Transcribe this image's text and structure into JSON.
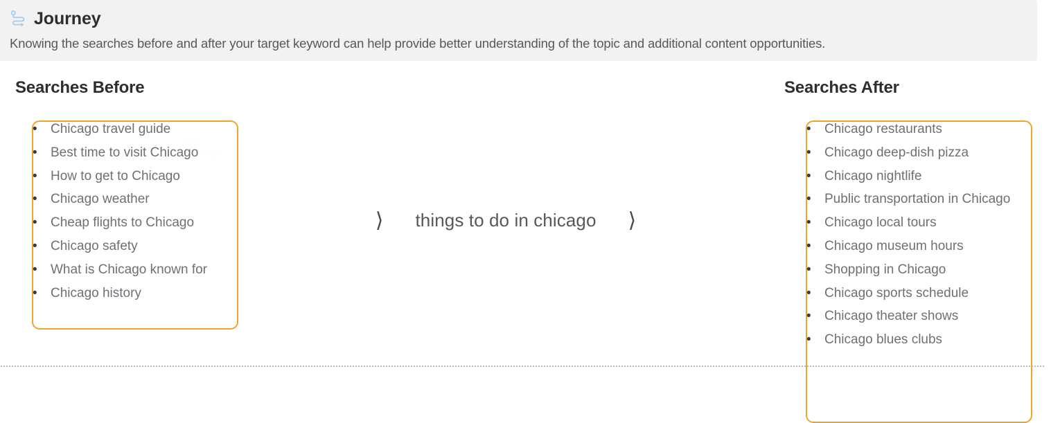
{
  "panel": {
    "icon": "route-journey-icon",
    "title": "Journey",
    "description": "Knowing the searches before and after your target keyword can help provide better understanding of the topic and additional content opportunities."
  },
  "colors": {
    "highlight_border": "#f0a52a",
    "icon_blue": "#a9cdef",
    "header_background": "#f2f2f2",
    "heading_text": "#2e2e2e",
    "list_text": "#6d7074"
  },
  "before": {
    "heading": "Searches Before",
    "items": [
      "Chicago travel guide",
      "Best time to visit Chicago",
      "How to get to Chicago",
      "Chicago weather",
      "Cheap flights to Chicago",
      "Chicago safety",
      "What is Chicago known for",
      "Chicago history"
    ]
  },
  "center": {
    "left_chevron": "⟩",
    "keyword": "things to do in chicago",
    "right_chevron": "⟩"
  },
  "after": {
    "heading": "Searches After",
    "items": [
      "Chicago restaurants",
      "Chicago deep-dish pizza",
      "Chicago nightlife",
      "Public transportation in Chicago",
      "Chicago local tours",
      "Chicago museum hours",
      "Shopping in Chicago",
      "Chicago sports schedule",
      "Chicago theater shows",
      "Chicago blues clubs"
    ]
  },
  "bullet": "•",
  "ghost_marks": {
    "a": "SE",
    "b": "ranking",
    "c": "SE",
    "d": "ranking"
  }
}
